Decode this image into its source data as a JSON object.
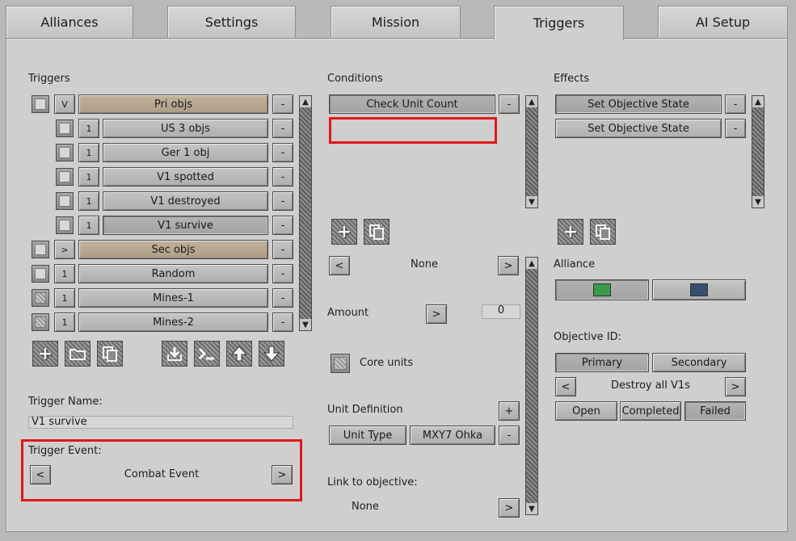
{
  "tabs": [
    "Alliances",
    "Settings",
    "Mission",
    "Triggers",
    "AI Setup"
  ],
  "triggers": {
    "heading": "Triggers",
    "rows": [
      {
        "count": "V",
        "name": "Pri objs"
      },
      {
        "count": "1",
        "name": "US 3 objs"
      },
      {
        "count": "1",
        "name": "Ger 1 obj"
      },
      {
        "count": "1",
        "name": "V1 spotted"
      },
      {
        "count": "1",
        "name": "V1 destroyed"
      },
      {
        "count": "1",
        "name": "V1 survive"
      },
      {
        "count": ">",
        "name": "Sec objs"
      },
      {
        "count": "1",
        "name": "Random"
      },
      {
        "count": "1",
        "name": "Mines-1"
      },
      {
        "count": "1",
        "name": "Mines-2"
      }
    ],
    "remove_label": "-",
    "name_label": "Trigger Name:",
    "name_value": "V1 survive",
    "event_label": "Trigger Event:",
    "event_value": "Combat Event",
    "prev": "<",
    "next": ">"
  },
  "conditions": {
    "heading": "Conditions",
    "items": [
      "Check Unit Count"
    ],
    "remove_label": "-",
    "selector_value": "None",
    "prev": "<",
    "next": ">",
    "amount_label": "Amount",
    "amount_value": "0",
    "core_units_label": "Core units",
    "unit_def_label": "Unit Definition",
    "add_label": "+",
    "unit_type": "Unit Type",
    "unit_name": "MXY7 Ohka",
    "link_label": "Link to objective:",
    "link_value": "None"
  },
  "effects": {
    "heading": "Effects",
    "items": [
      "Set Objective State",
      "Set Objective State"
    ],
    "remove_label": "-",
    "alliance_label": "Alliance",
    "alliance_colors": [
      "#3a9a4a",
      "#34506e"
    ],
    "objective_label": "Objective ID:",
    "primary": "Primary",
    "secondary": "Secondary",
    "objective_value": "Destroy all V1s",
    "prev": "<",
    "next": ">",
    "states": [
      "Open",
      "Completed",
      "Failed"
    ]
  },
  "icons": {
    "add": "plus-icon",
    "folder": "folder-icon",
    "copy": "copy-icon",
    "import": "import-icon",
    "console": "console-icon",
    "up": "arrow-up-icon",
    "down": "arrow-down-icon"
  }
}
